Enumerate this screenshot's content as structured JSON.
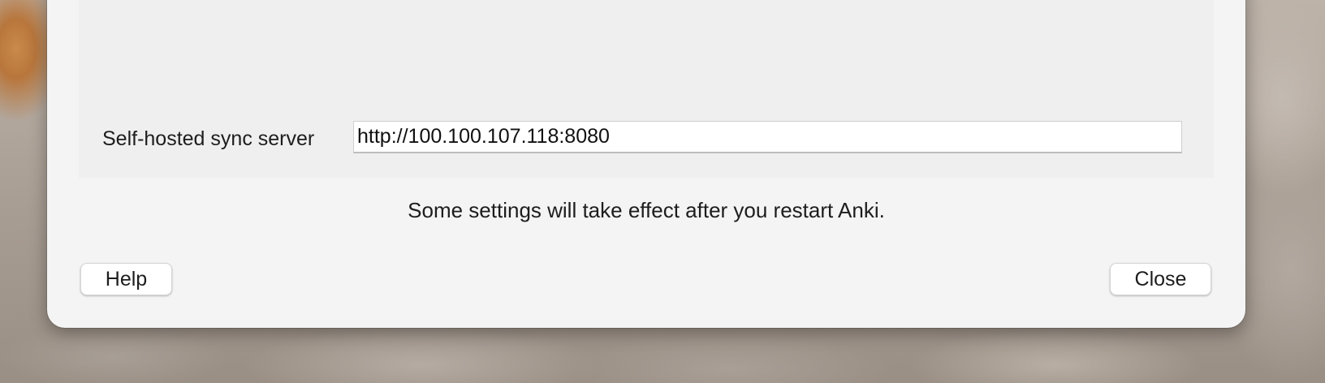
{
  "sync": {
    "server_label": "Self-hosted sync server",
    "server_value": "http://100.100.107.118:8080"
  },
  "notice": "Some settings will take effect after you restart Anki.",
  "buttons": {
    "help": "Help",
    "close": "Close"
  }
}
